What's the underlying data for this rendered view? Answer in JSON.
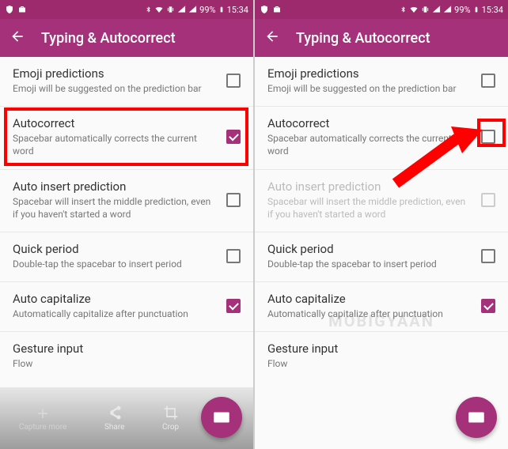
{
  "status": {
    "battery": "99%",
    "time": "15:34"
  },
  "toolbar": {
    "title": "Typing & Autocorrect"
  },
  "rows": {
    "emoji": {
      "title": "Emoji predictions",
      "sub": "Emoji will be suggested on the prediction bar"
    },
    "auto": {
      "title": "Autocorrect",
      "sub": "Spacebar automatically corrects the current word"
    },
    "insert": {
      "title": "Auto insert prediction",
      "sub": "Spacebar will insert the middle prediction, even if you haven't started a word"
    },
    "period": {
      "title": "Quick period",
      "sub": "Double-tap the spacebar to insert period"
    },
    "cap": {
      "title": "Auto capitalize",
      "sub": "Automatically capitalize after punctuation"
    },
    "gesture": {
      "title": "Gesture input",
      "sub": "Flow"
    }
  },
  "bottombar": {
    "capture": "Capture more",
    "share": "Share",
    "crop": "Crop"
  },
  "watermark": "MOBIGYAAN"
}
